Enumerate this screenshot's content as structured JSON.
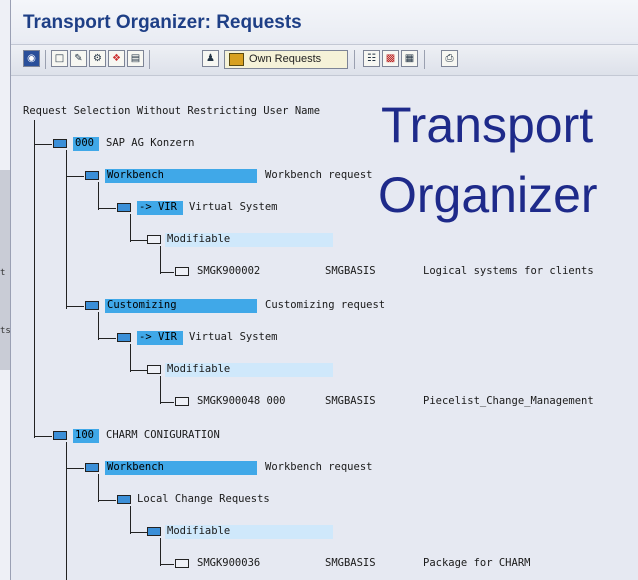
{
  "window": {
    "title": "Transport Organizer: Requests"
  },
  "toolbar": {
    "own_requests_label": "Own Requests",
    "icons": [
      "display-change-icon",
      "new-document-icon",
      "edit-icon",
      "transport-icon",
      "release-icon",
      "delete-icon",
      "user-icon",
      "own-requests-icon",
      "expand-icon",
      "truck-icon",
      "document-icon",
      "print-icon"
    ]
  },
  "tree": {
    "header": "Request Selection Without Restricting User Name",
    "rows": [
      {
        "id": "000",
        "label": "SAP AG Konzern"
      },
      {
        "id": "Workbench",
        "desc": "Workbench request"
      },
      {
        "id": "-> VIR",
        "label": "Virtual System"
      },
      {
        "id": "Modifiable"
      },
      {
        "id": "SMGK900002",
        "owner": "SMGBASIS",
        "desc": "Logical systems for clients"
      },
      {
        "id": "Customizing",
        "desc": "Customizing request"
      },
      {
        "id": "-> VIR",
        "label": "Virtual System"
      },
      {
        "id": "Modifiable"
      },
      {
        "id": "SMGK900048 000",
        "owner": "SMGBASIS",
        "desc": "Piecelist_Change_Management"
      },
      {
        "id": "100",
        "label": "CHARM CONIGURATION"
      },
      {
        "id": "Workbench",
        "desc": "Workbench request"
      },
      {
        "label": "Local Change Requests"
      },
      {
        "id": "Modifiable"
      },
      {
        "id": "SMGK900036",
        "owner": "SMGBASIS",
        "desc": "Package for CHARM"
      }
    ]
  },
  "overlay": {
    "line1": "Transport",
    "line2": "Organizer"
  },
  "background_fragments": [
    "t",
    "ts"
  ]
}
